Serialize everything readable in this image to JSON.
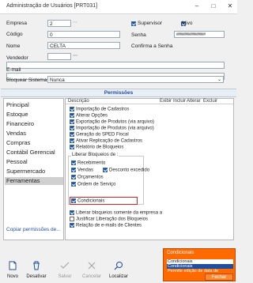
{
  "window": {
    "title": "Administração de Usuários [PRT031]"
  },
  "form": {
    "empresa": {
      "label": "Empresa",
      "value": "2"
    },
    "codigo": {
      "label": "Código",
      "value": "0"
    },
    "nome": {
      "label": "Nome",
      "value": "CELTA"
    },
    "vendedor": {
      "label": "Vendedor",
      "value": ""
    },
    "email": {
      "label": "E-mail",
      "value": ""
    },
    "bloquear": {
      "label": "Bloquear Sistema",
      "value": "Nunca"
    },
    "supervisor": {
      "label": "Supervisor",
      "checked": true
    },
    "ativo": {
      "label": "Ativo",
      "checked": true
    },
    "senha": {
      "label": "Senha",
      "value": "################"
    },
    "confirma": {
      "label": "Confirma a Senha",
      "value": ""
    }
  },
  "permissions": {
    "title": "Permissões",
    "categories": [
      "Principal",
      "Estoque",
      "Financeiro",
      "Vendas",
      "Compras",
      "Contábil Gerencial",
      "Pessoal",
      "Supermercado",
      "Ferramentas"
    ],
    "selected_category": "Ferramentas",
    "headers": {
      "descricao": "Descrição",
      "exibir": "Exibir",
      "incluir": "Incluir",
      "alterar": "Alterar",
      "excluir": "Excluir"
    },
    "items": [
      "Importação de Cadastros",
      "Alterar Opções",
      "Exportação de Produtos  (via arquivo)",
      "Importação de Produtos  (via arquivo)",
      "Geração do SPED Fiscal",
      "Ativar Replicação de Cadastros",
      "Relatório de Bloqueios"
    ],
    "liberar_title": "Liberar Bloqueios de :",
    "liberar": {
      "recebimento": "Recebimento",
      "vendas": "Vendas",
      "desconto": "Desconto excedido",
      "orcamentos": "Orçamentos",
      "ordem": "Ordem de Serviço",
      "condicionais": "Condicionais"
    },
    "extra": [
      "Liberar bloqueios somente da empresa a",
      "Justificar Liberação dos Bloqueios",
      "Relação de e-mails de Clientes"
    ],
    "copy_link": "Copiar permissões de..."
  },
  "popup": {
    "title": "Condicionais",
    "rows": [
      "Condicionais",
      "Condicionais",
      "Permite edição de data de"
    ],
    "button": "Fechar"
  },
  "toolbar": {
    "novo": "Novo",
    "desativar": "Desativar",
    "salvar": "Salvar",
    "cancelar": "Cancelar",
    "localizar": "Localizar"
  }
}
